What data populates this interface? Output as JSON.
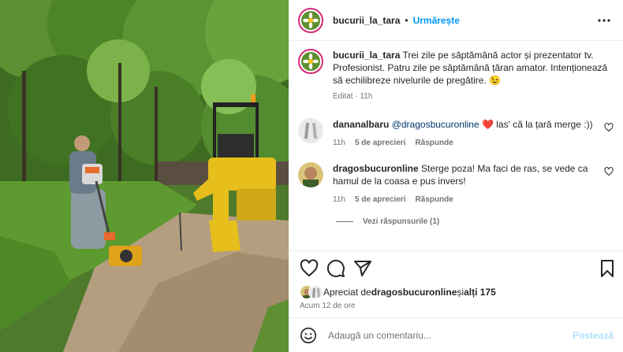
{
  "post": {
    "author": "bucurii_la_tara",
    "follow_label": "Urmărește",
    "separator": "•",
    "caption_text": "Trei zile pe săptămână actor și prezentator tv. Profesionist. Patru zile pe săptămână țăran amator. Intenționează să echilibreze nivelurile de pregătire. 😉",
    "caption_meta": "Editat · 11h"
  },
  "comments": [
    {
      "author": "dananalbaru",
      "mention": "@dragosbucuronline",
      "text": " ❤️  las' că la țară merge :))",
      "time": "11h",
      "likes": "5 de aprecieri",
      "reply": "Răspunde"
    },
    {
      "author": "dragosbucuronline",
      "text": "Sterge poza! Ma faci de ras, se vede ca hamul de la coasa e pus invers!",
      "time": "11h",
      "likes": "5 de aprecieri",
      "reply": "Răspunde"
    }
  ],
  "replies_label": "Vezi răspunsurile (1)",
  "likes": {
    "prefix": "Apreciat de ",
    "user": "dragosbucuronline",
    "conj": " și ",
    "others": "alți 175"
  },
  "timestamp": "Acum 12 de ore",
  "comment_box": {
    "placeholder": "Adaugă un comentariu...",
    "post_label": "Postează"
  },
  "icons": [
    "more-icon",
    "heart-icon",
    "comment-icon",
    "share-icon",
    "bookmark-icon",
    "emoji-icon"
  ],
  "colors": {
    "accent": "#0095f6",
    "post_disabled": "#b2dffc",
    "muted": "#737373",
    "text": "#262626",
    "story_ring": "#d62976"
  }
}
